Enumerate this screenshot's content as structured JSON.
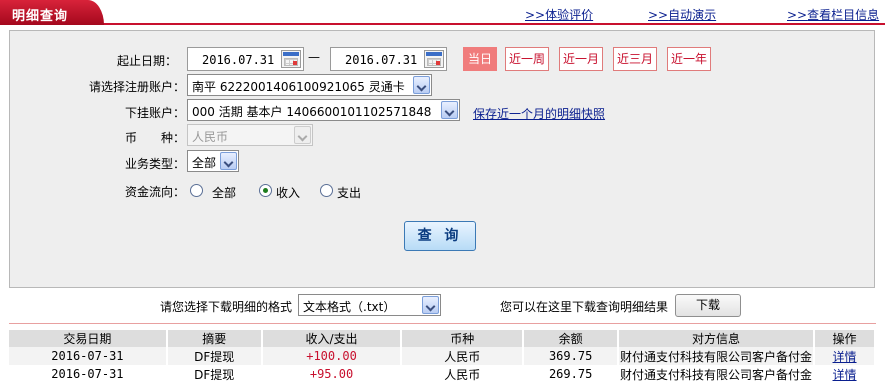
{
  "header": {
    "title": "明细查询",
    "links": [
      "体验评价",
      "自动演示",
      "查看栏目信息"
    ]
  },
  "form": {
    "date_label": "起止日期：",
    "start_date": "2016.07.31",
    "end_date": "2016.07.31",
    "date_sep": "—",
    "quick_ranges": [
      "当日",
      "近一周",
      "近一月",
      "近三月",
      "近一年"
    ],
    "reg_account_label": "请选择注册账户：",
    "reg_account_value": "南平 6222001406100921065 灵通卡",
    "sub_account_label": "下挂账户：",
    "sub_account_value": "000 活期 基本户 1406600101102571848",
    "snapshot_link": "保存近一个月的明细快照",
    "currency_label": "币　　种：",
    "currency_value": "人民币",
    "biz_type_label": "业务类型：",
    "biz_type_value": "全部",
    "flow_label": "资金流向：",
    "flow_options": [
      "全部",
      "收入",
      "支出"
    ],
    "flow_selected": "收入",
    "query_button": "查 询"
  },
  "download": {
    "label": "请您选择下载明细的格式",
    "format": "文本格式（.txt）",
    "hint": "您可以在这里下载查询明细结果",
    "button": "下载"
  },
  "table": {
    "columns": [
      "交易日期",
      "摘要",
      "收入/支出",
      "币种",
      "余额",
      "对方信息",
      "操作"
    ],
    "rows": [
      [
        "2016-07-31",
        "DF提现",
        "+100.00",
        "人民币",
        "369.75",
        "财付通支付科技有限公司客户备付金",
        "详情"
      ],
      [
        "2016-07-31",
        "DF提现",
        "+95.00",
        "人民币",
        "269.75",
        "财付通支付科技有限公司客户备付金",
        "详情"
      ]
    ]
  },
  "colors": {
    "brand": "#c8102e",
    "link": "#0a1f8f"
  }
}
